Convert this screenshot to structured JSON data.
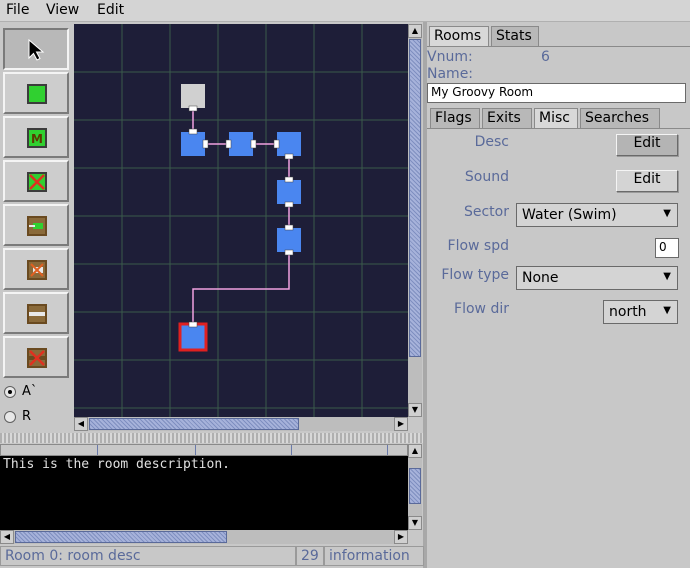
{
  "menu": {
    "file": "File",
    "view": "View",
    "edit": "Edit"
  },
  "palette": {
    "tools": [
      {
        "icon": "arrow-pointer-icon"
      },
      {
        "icon": "room-icon"
      },
      {
        "icon": "mob-room-icon",
        "glyph": "M"
      },
      {
        "icon": "delete-room-icon"
      },
      {
        "icon": "add-exit-icon"
      },
      {
        "icon": "delete-exit-icon"
      },
      {
        "icon": "link-rooms-icon"
      },
      {
        "icon": "unlink-rooms-icon"
      }
    ],
    "radio_a": "A`",
    "radio_r": "R",
    "selected_radio": "A`"
  },
  "map": {
    "background": "#1e1e38",
    "room_color": "#4a86f0",
    "selected_room_border": "#e02020",
    "exit_line_color": "#f0a0e0"
  },
  "description": {
    "text": "This is the room description."
  },
  "status": {
    "room": "Room 0: room desc",
    "count": "29",
    "level": "information"
  },
  "right_panel": {
    "tabs": [
      "Rooms",
      "Stats"
    ],
    "vnum_label": "Vnum:",
    "vnum_value": "6",
    "name_label": "Name:",
    "name_value": "My Groovy Room",
    "subtabs": [
      "Flags",
      "Exits",
      "Misc",
      "Searches"
    ],
    "active_subtab": "Misc",
    "desc_label": "Desc",
    "desc_button": "Edit",
    "sound_label": "Sound",
    "sound_button": "Edit",
    "sector_label": "Sector",
    "sector_value": "Water (Swim)",
    "flowspd_label": "Flow spd",
    "flowspd_value": "0",
    "flowtype_label": "Flow type",
    "flowtype_value": "None",
    "flowdir_label": "Flow dir",
    "flowdir_value": "north"
  }
}
